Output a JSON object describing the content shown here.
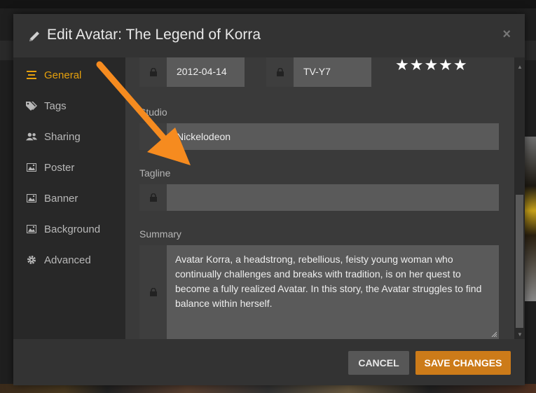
{
  "modal": {
    "title": "Edit Avatar: The Legend of Korra",
    "close_label": "×"
  },
  "sidebar": {
    "items": [
      {
        "label": "General",
        "icon": "list-icon",
        "active": true
      },
      {
        "label": "Tags",
        "icon": "tag-icon",
        "active": false
      },
      {
        "label": "Sharing",
        "icon": "users-icon",
        "active": false
      },
      {
        "label": "Poster",
        "icon": "image-icon",
        "active": false
      },
      {
        "label": "Banner",
        "icon": "image-icon",
        "active": false
      },
      {
        "label": "Background",
        "icon": "image-icon",
        "active": false
      },
      {
        "label": "Advanced",
        "icon": "gear-icon",
        "active": false
      }
    ]
  },
  "form": {
    "date_value": "2012-04-14",
    "rating_value": "TV-Y7",
    "stars": "★★★★★",
    "studio_label": "Studio",
    "studio_value": "Nickelodeon",
    "tagline_label": "Tagline",
    "tagline_value": "",
    "summary_label": "Summary",
    "summary_value": "Avatar Korra, a headstrong, rebellious, feisty young woman who continually challenges and breaks with tradition, is on her quest to become a fully realized Avatar. In this story, the Avatar struggles to find balance within herself."
  },
  "footer": {
    "cancel_label": "CANCEL",
    "save_label": "SAVE CHANGES"
  },
  "colors": {
    "accent": "#e5a00d",
    "save_button": "#cc7b19",
    "annotation_arrow": "#f68b1f"
  }
}
